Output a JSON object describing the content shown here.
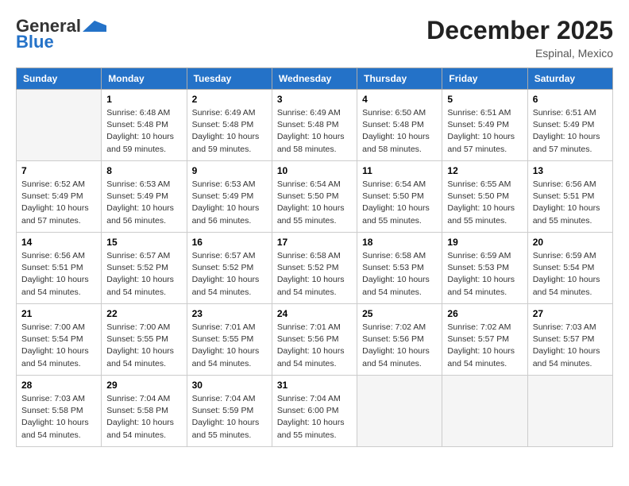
{
  "header": {
    "logo_line1": "General",
    "logo_line2": "Blue",
    "month": "December 2025",
    "location": "Espinal, Mexico"
  },
  "weekdays": [
    "Sunday",
    "Monday",
    "Tuesday",
    "Wednesday",
    "Thursday",
    "Friday",
    "Saturday"
  ],
  "weeks": [
    [
      {
        "day": "",
        "sunrise": "",
        "sunset": "",
        "daylight": ""
      },
      {
        "day": "1",
        "sunrise": "Sunrise: 6:48 AM",
        "sunset": "Sunset: 5:48 PM",
        "daylight": "Daylight: 10 hours and 59 minutes."
      },
      {
        "day": "2",
        "sunrise": "Sunrise: 6:49 AM",
        "sunset": "Sunset: 5:48 PM",
        "daylight": "Daylight: 10 hours and 59 minutes."
      },
      {
        "day": "3",
        "sunrise": "Sunrise: 6:49 AM",
        "sunset": "Sunset: 5:48 PM",
        "daylight": "Daylight: 10 hours and 58 minutes."
      },
      {
        "day": "4",
        "sunrise": "Sunrise: 6:50 AM",
        "sunset": "Sunset: 5:48 PM",
        "daylight": "Daylight: 10 hours and 58 minutes."
      },
      {
        "day": "5",
        "sunrise": "Sunrise: 6:51 AM",
        "sunset": "Sunset: 5:49 PM",
        "daylight": "Daylight: 10 hours and 57 minutes."
      },
      {
        "day": "6",
        "sunrise": "Sunrise: 6:51 AM",
        "sunset": "Sunset: 5:49 PM",
        "daylight": "Daylight: 10 hours and 57 minutes."
      }
    ],
    [
      {
        "day": "7",
        "sunrise": "Sunrise: 6:52 AM",
        "sunset": "Sunset: 5:49 PM",
        "daylight": "Daylight: 10 hours and 57 minutes."
      },
      {
        "day": "8",
        "sunrise": "Sunrise: 6:53 AM",
        "sunset": "Sunset: 5:49 PM",
        "daylight": "Daylight: 10 hours and 56 minutes."
      },
      {
        "day": "9",
        "sunrise": "Sunrise: 6:53 AM",
        "sunset": "Sunset: 5:49 PM",
        "daylight": "Daylight: 10 hours and 56 minutes."
      },
      {
        "day": "10",
        "sunrise": "Sunrise: 6:54 AM",
        "sunset": "Sunset: 5:50 PM",
        "daylight": "Daylight: 10 hours and 55 minutes."
      },
      {
        "day": "11",
        "sunrise": "Sunrise: 6:54 AM",
        "sunset": "Sunset: 5:50 PM",
        "daylight": "Daylight: 10 hours and 55 minutes."
      },
      {
        "day": "12",
        "sunrise": "Sunrise: 6:55 AM",
        "sunset": "Sunset: 5:50 PM",
        "daylight": "Daylight: 10 hours and 55 minutes."
      },
      {
        "day": "13",
        "sunrise": "Sunrise: 6:56 AM",
        "sunset": "Sunset: 5:51 PM",
        "daylight": "Daylight: 10 hours and 55 minutes."
      }
    ],
    [
      {
        "day": "14",
        "sunrise": "Sunrise: 6:56 AM",
        "sunset": "Sunset: 5:51 PM",
        "daylight": "Daylight: 10 hours and 54 minutes."
      },
      {
        "day": "15",
        "sunrise": "Sunrise: 6:57 AM",
        "sunset": "Sunset: 5:52 PM",
        "daylight": "Daylight: 10 hours and 54 minutes."
      },
      {
        "day": "16",
        "sunrise": "Sunrise: 6:57 AM",
        "sunset": "Sunset: 5:52 PM",
        "daylight": "Daylight: 10 hours and 54 minutes."
      },
      {
        "day": "17",
        "sunrise": "Sunrise: 6:58 AM",
        "sunset": "Sunset: 5:52 PM",
        "daylight": "Daylight: 10 hours and 54 minutes."
      },
      {
        "day": "18",
        "sunrise": "Sunrise: 6:58 AM",
        "sunset": "Sunset: 5:53 PM",
        "daylight": "Daylight: 10 hours and 54 minutes."
      },
      {
        "day": "19",
        "sunrise": "Sunrise: 6:59 AM",
        "sunset": "Sunset: 5:53 PM",
        "daylight": "Daylight: 10 hours and 54 minutes."
      },
      {
        "day": "20",
        "sunrise": "Sunrise: 6:59 AM",
        "sunset": "Sunset: 5:54 PM",
        "daylight": "Daylight: 10 hours and 54 minutes."
      }
    ],
    [
      {
        "day": "21",
        "sunrise": "Sunrise: 7:00 AM",
        "sunset": "Sunset: 5:54 PM",
        "daylight": "Daylight: 10 hours and 54 minutes."
      },
      {
        "day": "22",
        "sunrise": "Sunrise: 7:00 AM",
        "sunset": "Sunset: 5:55 PM",
        "daylight": "Daylight: 10 hours and 54 minutes."
      },
      {
        "day": "23",
        "sunrise": "Sunrise: 7:01 AM",
        "sunset": "Sunset: 5:55 PM",
        "daylight": "Daylight: 10 hours and 54 minutes."
      },
      {
        "day": "24",
        "sunrise": "Sunrise: 7:01 AM",
        "sunset": "Sunset: 5:56 PM",
        "daylight": "Daylight: 10 hours and 54 minutes."
      },
      {
        "day": "25",
        "sunrise": "Sunrise: 7:02 AM",
        "sunset": "Sunset: 5:56 PM",
        "daylight": "Daylight: 10 hours and 54 minutes."
      },
      {
        "day": "26",
        "sunrise": "Sunrise: 7:02 AM",
        "sunset": "Sunset: 5:57 PM",
        "daylight": "Daylight: 10 hours and 54 minutes."
      },
      {
        "day": "27",
        "sunrise": "Sunrise: 7:03 AM",
        "sunset": "Sunset: 5:57 PM",
        "daylight": "Daylight: 10 hours and 54 minutes."
      }
    ],
    [
      {
        "day": "28",
        "sunrise": "Sunrise: 7:03 AM",
        "sunset": "Sunset: 5:58 PM",
        "daylight": "Daylight: 10 hours and 54 minutes."
      },
      {
        "day": "29",
        "sunrise": "Sunrise: 7:04 AM",
        "sunset": "Sunset: 5:58 PM",
        "daylight": "Daylight: 10 hours and 54 minutes."
      },
      {
        "day": "30",
        "sunrise": "Sunrise: 7:04 AM",
        "sunset": "Sunset: 5:59 PM",
        "daylight": "Daylight: 10 hours and 55 minutes."
      },
      {
        "day": "31",
        "sunrise": "Sunrise: 7:04 AM",
        "sunset": "Sunset: 6:00 PM",
        "daylight": "Daylight: 10 hours and 55 minutes."
      },
      {
        "day": "",
        "sunrise": "",
        "sunset": "",
        "daylight": ""
      },
      {
        "day": "",
        "sunrise": "",
        "sunset": "",
        "daylight": ""
      },
      {
        "day": "",
        "sunrise": "",
        "sunset": "",
        "daylight": ""
      }
    ]
  ]
}
